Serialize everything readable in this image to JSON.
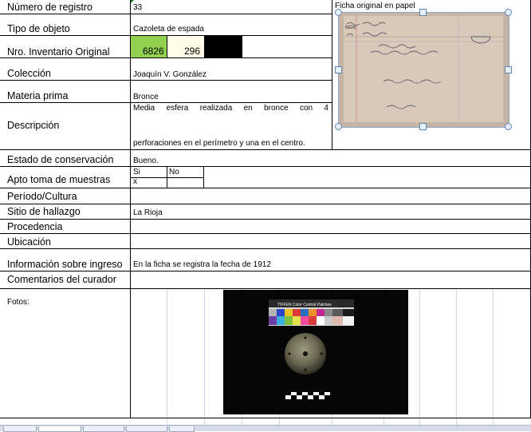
{
  "rows": {
    "registro": {
      "label": "Número de registro",
      "value": "33"
    },
    "tipo": {
      "label": "Tipo de objeto",
      "value": "Cazoleta de espada"
    },
    "inventario": {
      "label": "Nro. Inventario Original",
      "value1": "6826",
      "value2": "296"
    },
    "coleccion": {
      "label": "Colección",
      "value": "Joaquín V. González"
    },
    "materia": {
      "label": "Materia prima",
      "value": "Bronce"
    },
    "descripcion": {
      "label": "Descripción",
      "line1": "Media esfera realizada en bronce con 4",
      "line2": "perforaciones en el perímetro y una en el centro."
    },
    "estado": {
      "label": "Estado de conservación",
      "value": "Bueno."
    },
    "apto": {
      "label": "Apto toma de muestras",
      "si": "Si",
      "no": "No",
      "mark": "x"
    },
    "periodo": {
      "label": "Período/Cultura",
      "value": ""
    },
    "sitio": {
      "label": "Sitio de hallazgo",
      "value": "La Rioja"
    },
    "procedencia": {
      "label": "Procedencia",
      "value": ""
    },
    "ubicacion": {
      "label": "Ubicación",
      "value": ""
    },
    "ingreso": {
      "label": "Información sobre  ingreso",
      "value": "En la ficha se registra la fecha de 1912"
    },
    "comentarios": {
      "label": "Comentarios del curador",
      "value": ""
    },
    "fotos": {
      "label": "Fotos:"
    }
  },
  "ficha": {
    "title": "Ficha original en papel"
  },
  "photo": {
    "color_card_title": "TIFFEN Color Control Patches"
  },
  "colors": {
    "green_cell": "#92d050",
    "frame_handle": "#5b86b8"
  }
}
